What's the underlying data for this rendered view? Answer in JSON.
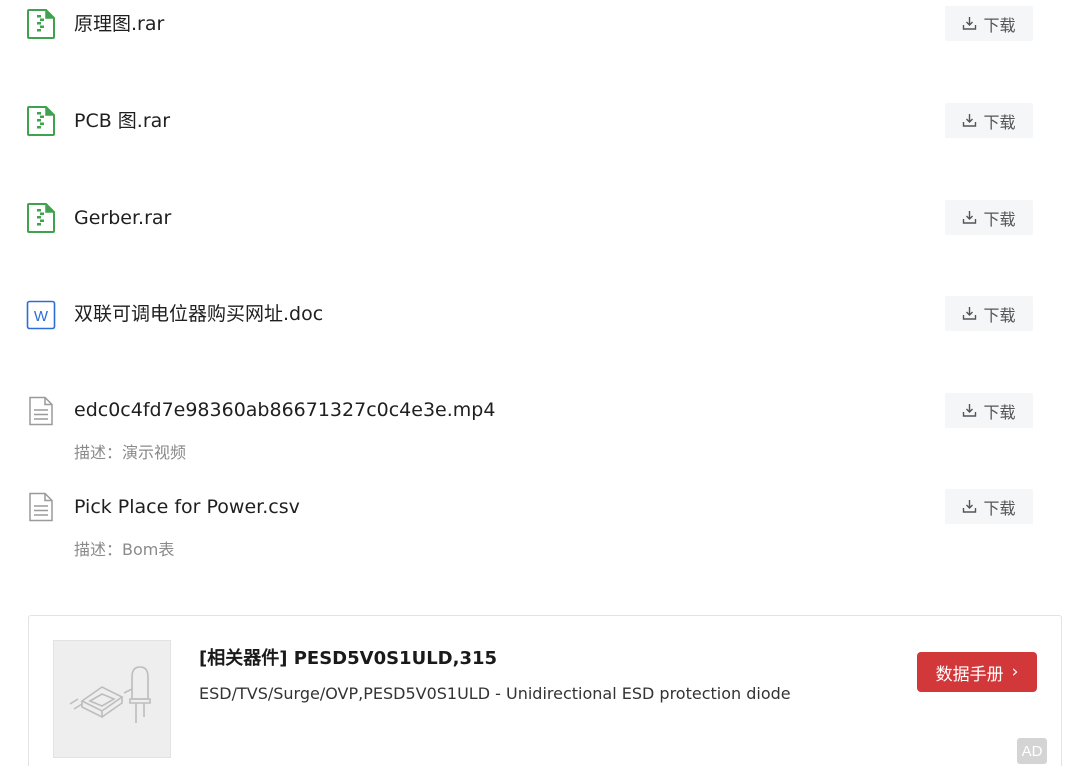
{
  "files": [
    {
      "name": "原理图.rar",
      "icon": "zip-file-icon",
      "desc": "",
      "download_label": "下载"
    },
    {
      "name": "PCB 图.rar",
      "icon": "zip-file-icon",
      "desc": "",
      "download_label": "下载"
    },
    {
      "name": "Gerber.rar",
      "icon": "zip-file-icon",
      "desc": "",
      "download_label": "下载"
    },
    {
      "name": "双联可调电位器购买网址.doc",
      "icon": "word-file-icon",
      "desc": "",
      "download_label": "下载"
    },
    {
      "name": "edc0c4fd7e98360ab86671327c0c4e3e.mp4",
      "icon": "document-file-icon",
      "desc": "描述：演示视频",
      "download_label": "下载"
    },
    {
      "name": "Pick Place for Power.csv",
      "icon": "document-file-icon",
      "desc": "描述：Bom表",
      "download_label": "下载"
    }
  ],
  "related": {
    "title": "[相关器件] PESD5V0S1ULD,315",
    "description": "ESD/TVS/Surge/OVP,PESD5V0S1ULD - Unidirectional ESD protection diode",
    "button_label": "数据手册",
    "button_chevron": "›",
    "ad_badge": "AD",
    "thumbnail_icon": "component-placeholder-icon"
  },
  "colors": {
    "zip_icon": "#3fa34d",
    "word_icon": "#2b6fd6",
    "doc_icon": "#9a9a9a",
    "primary_button": "#d2373a"
  }
}
